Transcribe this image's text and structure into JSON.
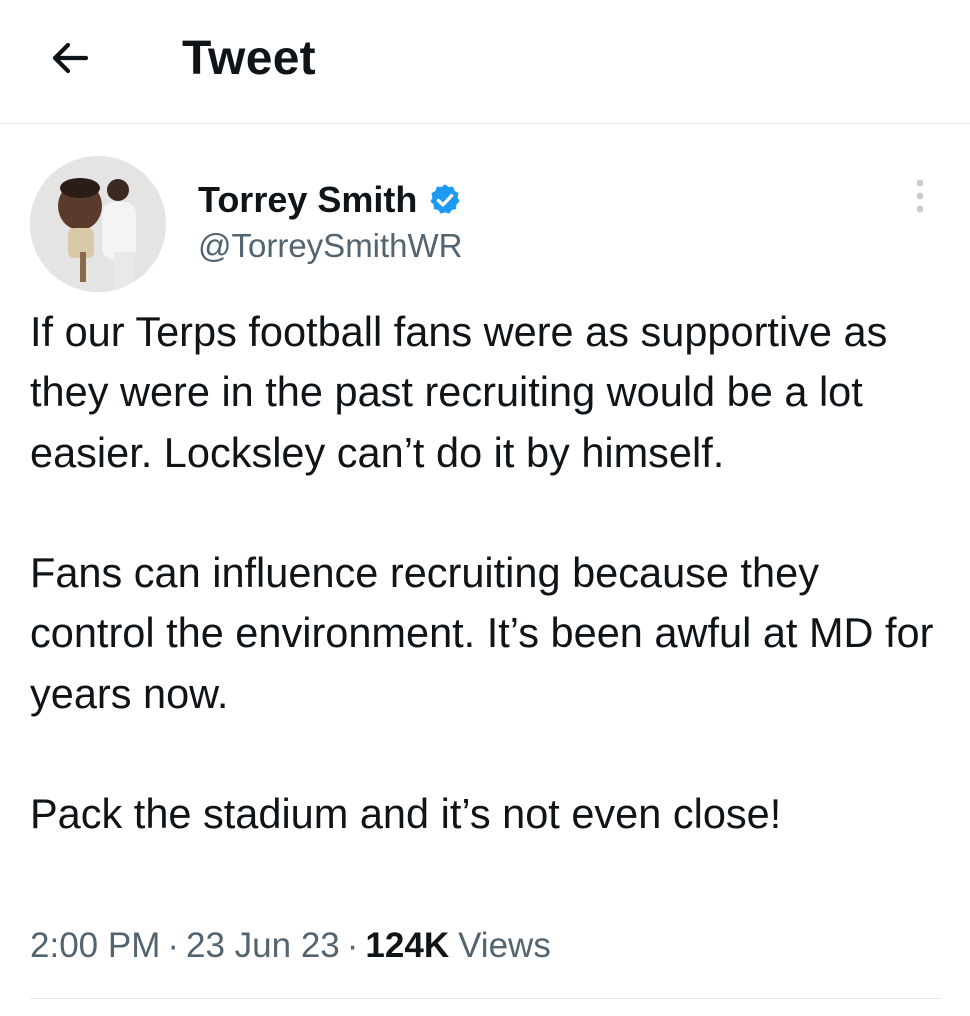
{
  "header": {
    "title": "Tweet",
    "back_icon": "arrow-left-icon"
  },
  "author": {
    "name": "Torrey Smith",
    "handle": "@TorreySmithWR",
    "verified": true,
    "verified_color": "#1d9bf0"
  },
  "tweet": {
    "text": "If our Terps football fans were as supportive as they were in the past recruiting would be a lot easier. Locksley can’t do it by himself.\n\nFans can influence recruiting because they control the environment. It’s been awful at MD for years now.\n\nPack the stadium and it’s not even close!",
    "time": "2:00 PM",
    "date": "23 Jun 23",
    "views_count": "124K",
    "views_label": "Views"
  },
  "colors": {
    "text_primary": "#0f1419",
    "text_secondary": "#536471",
    "divider": "#e6e9ec"
  }
}
